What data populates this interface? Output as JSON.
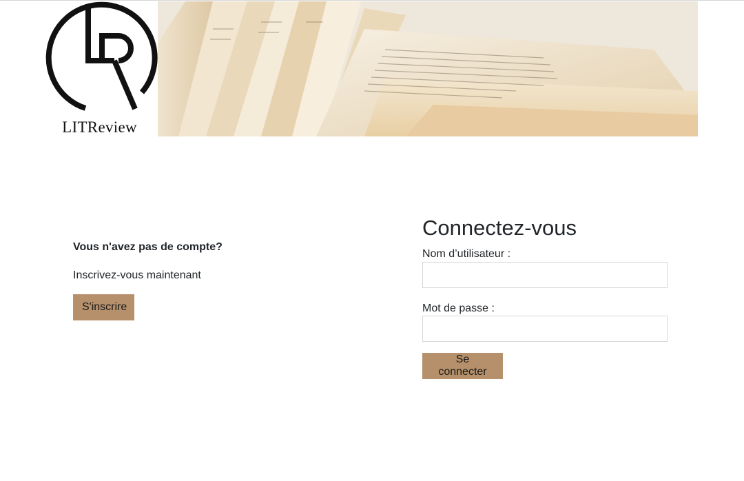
{
  "header": {
    "logo_text": "LITReview",
    "banner": "open-book-pages-image"
  },
  "signup": {
    "question": "Vous n'avez pas de compte?",
    "text": "Inscrivez-vous maintenant",
    "button_label": "S'inscrire"
  },
  "login": {
    "title": "Connectez-vous",
    "username_label": "Nom d’utilisateur :",
    "username_value": "",
    "password_label": "Mot de passe :",
    "password_value": "",
    "button_label": "Se connecter"
  },
  "colors": {
    "button_bg": "#b5906a",
    "text": "#212529",
    "input_border": "#d7d7d7"
  }
}
